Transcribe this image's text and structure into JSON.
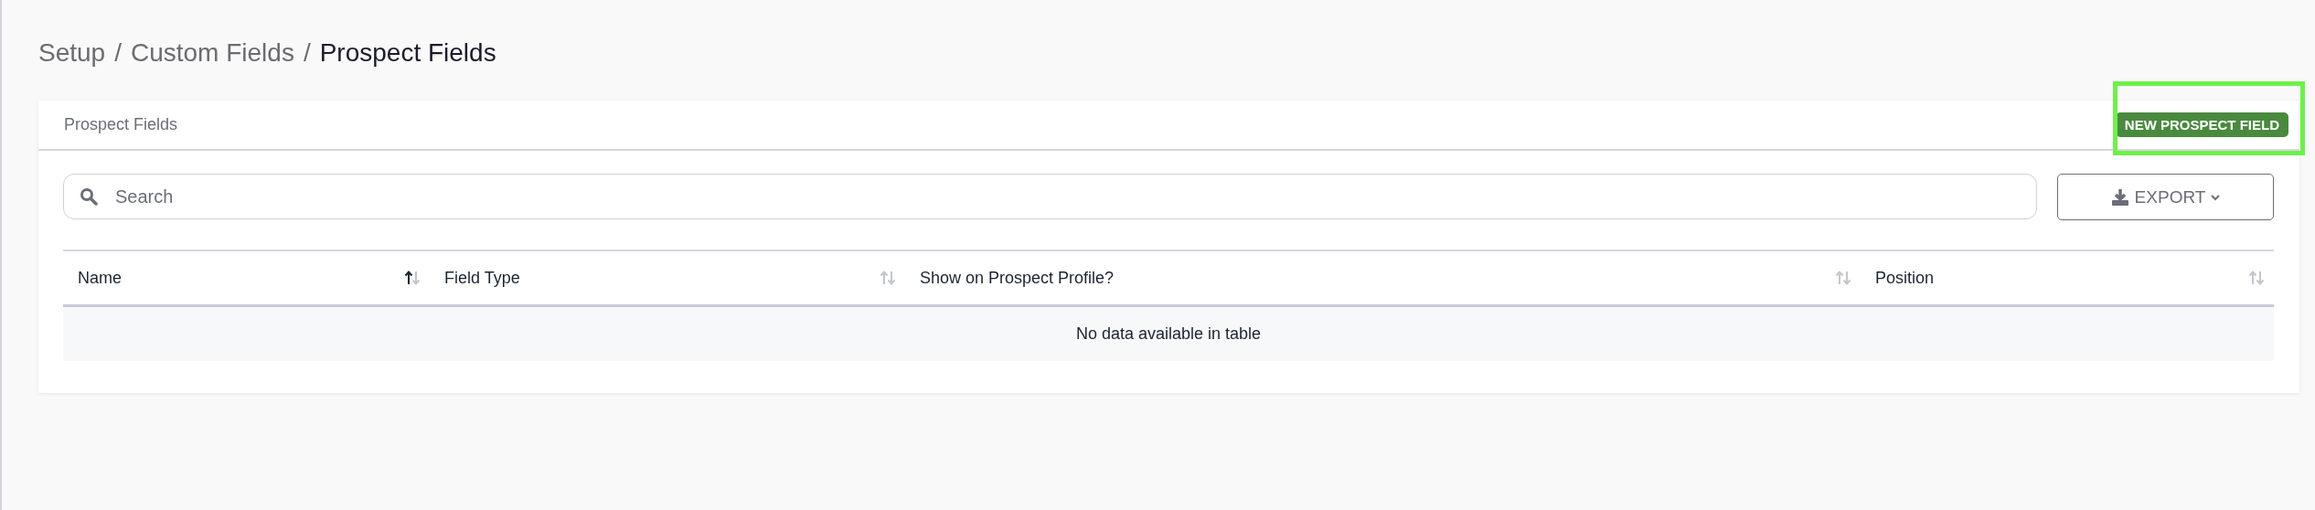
{
  "breadcrumb": [
    {
      "label": "Setup",
      "kind": "crumb",
      "current": false
    },
    {
      "label": "/",
      "kind": "separator"
    },
    {
      "label": "Custom Fields",
      "kind": "crumb",
      "current": false
    },
    {
      "label": "/",
      "kind": "separator"
    },
    {
      "label": "Prospect Fields",
      "kind": "crumb",
      "current": true
    }
  ],
  "card": {
    "title": "Prospect Fields",
    "new_button": {
      "label": "NEW PROSPECT FIELD",
      "highlighted": true
    },
    "search": {
      "placeholder": "Search"
    },
    "export_button": {
      "label": "EXPORT"
    },
    "table": {
      "columns": [
        {
          "label": "Name",
          "sorted": true
        },
        {
          "label": "Field Type",
          "sorted": false
        },
        {
          "label": "Show on Prospect Profile?",
          "sorted": false
        },
        {
          "label": "Position",
          "sorted": false
        }
      ],
      "empty_message": "No data available in table"
    }
  }
}
